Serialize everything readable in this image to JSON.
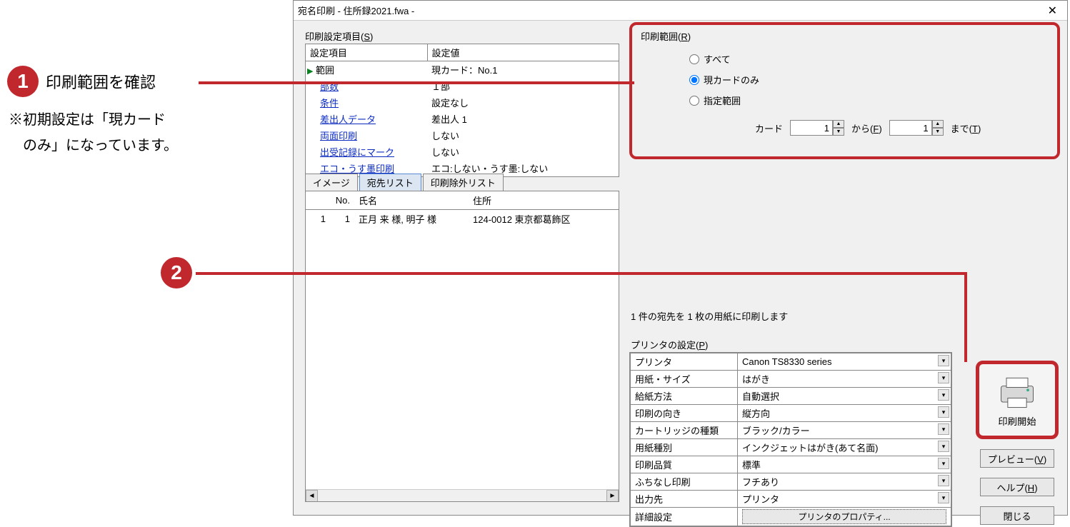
{
  "annotations": {
    "num1": "1",
    "text1": "印刷範囲を確認",
    "note_l1": "※初期設定は「現カード",
    "note_l2": "　のみ」になっています。",
    "num2": "2"
  },
  "titlebar": {
    "title": "宛名印刷  - 住所録2021.fwa -",
    "close": "✕"
  },
  "settings": {
    "label": "印刷設定項目(",
    "label_u": "S",
    "label_end": ")",
    "header_item": "設定項目",
    "header_value": "設定値",
    "rows": [
      {
        "name": "範囲",
        "value": "現カード：No.1",
        "current": true
      },
      {
        "name": "部数",
        "value": "１部"
      },
      {
        "name": "条件",
        "value": "設定なし"
      },
      {
        "name": "差出人データ",
        "value": "差出人 1"
      },
      {
        "name": "両面印刷",
        "value": "しない"
      },
      {
        "name": "出受記録にマーク",
        "value": "しない"
      },
      {
        "name": "エコ・うす墨印刷",
        "value": "エコ:しない・うす墨:しない"
      }
    ]
  },
  "tabs": {
    "image": "イメージ",
    "addr_list": "宛先リスト",
    "exclude": "印刷除外リスト"
  },
  "addr": {
    "h_blank": "",
    "h_no": "No.",
    "h_name": "氏名",
    "h_address": "住所",
    "rows": [
      {
        "idx": "1",
        "no": "1",
        "name": "正月 来 様, 明子 様",
        "address": "124-0012 東京都葛飾区"
      }
    ]
  },
  "range": {
    "label": "印刷範囲(",
    "label_u": "R",
    "label_end": ")",
    "opt_all": "すべて",
    "opt_current": "現カードのみ",
    "opt_range": "指定範囲",
    "card_label": "カード",
    "from_val": "1",
    "from_label": "から(",
    "from_u": "F",
    "from_end": ")",
    "to_val": "1",
    "to_label": "まで(",
    "to_u": "T",
    "to_end": ")"
  },
  "status": "1 件の宛先を 1 枚の用紙に印刷します",
  "printer": {
    "label": "プリンタの設定(",
    "label_u": "P",
    "label_end": ")",
    "rows": [
      {
        "k": "プリンタ",
        "v": "Canon TS8330 series"
      },
      {
        "k": "用紙・サイズ",
        "v": "はがき"
      },
      {
        "k": "給紙方法",
        "v": "自動選択"
      },
      {
        "k": "印刷の向き",
        "v": "縦方向"
      },
      {
        "k": "カートリッジの種類",
        "v": "ブラック/カラー"
      },
      {
        "k": "用紙種別",
        "v": "インクジェットはがき(あて名面)"
      },
      {
        "k": "印刷品質",
        "v": "標準"
      },
      {
        "k": "ふちなし印刷",
        "v": "フチあり"
      },
      {
        "k": "出力先",
        "v": "プリンタ"
      }
    ],
    "detail_k": "詳細設定",
    "properties_btn": "プリンタのプロパティ..."
  },
  "buttons": {
    "print_start": "印刷開始",
    "preview": "プレビュー(",
    "preview_u": "V",
    "preview_end": ")",
    "help": "ヘルプ(",
    "help_u": "H",
    "help_end": ")",
    "close": "閉じる"
  }
}
